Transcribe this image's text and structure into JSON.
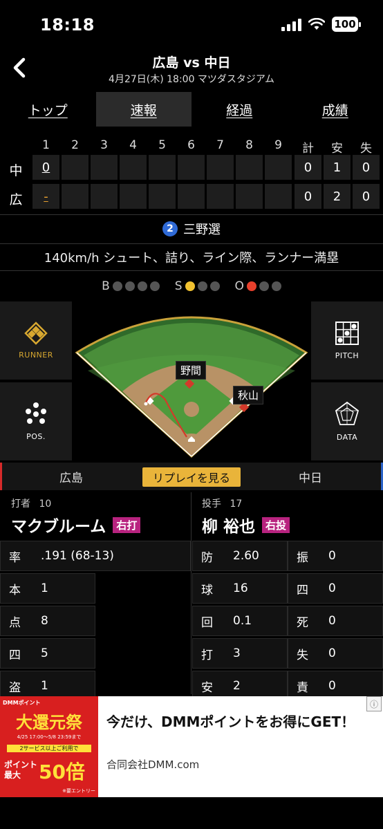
{
  "status_bar": {
    "time": "18:18",
    "battery": "100"
  },
  "header": {
    "title": "広島 vs 中日",
    "subtitle": "4月27日(木) 18:00 マツダスタジアム"
  },
  "tabs": [
    {
      "label": "トップ"
    },
    {
      "label": "速報"
    },
    {
      "label": "経過"
    },
    {
      "label": "成績"
    }
  ],
  "scoreboard": {
    "innings": [
      "1",
      "2",
      "3",
      "4",
      "5",
      "6",
      "7",
      "8",
      "9"
    ],
    "totals_headers": [
      "計",
      "安",
      "失"
    ],
    "rows": [
      {
        "team": "中",
        "innings": [
          "0",
          "",
          "",
          "",
          "",
          "",
          "",
          "",
          ""
        ],
        "totals": [
          "0",
          "1",
          "0"
        ]
      },
      {
        "team": "広",
        "innings": [
          "-",
          "",
          "",
          "",
          "",
          "",
          "",
          "",
          ""
        ],
        "totals": [
          "0",
          "2",
          "0"
        ]
      }
    ]
  },
  "at_bat": {
    "order": "2",
    "text": "三野選"
  },
  "play_description": "140km/h シュート、詰り、ライン際、ランナー満塁",
  "count": {
    "b_label": "B",
    "s_label": "S",
    "o_label": "O",
    "balls": 0,
    "strikes": 1,
    "outs": 1,
    "colors": {
      "strike": "#f2c230",
      "out": "#e8402c",
      "off": "#555555"
    }
  },
  "field": {
    "fielders": [
      "野間",
      "秋山"
    ],
    "buttons": {
      "runner": "RUNNER",
      "pitch": "PITCH",
      "pos": "POS.",
      "data": "DATA"
    }
  },
  "team_bar": {
    "home": "広島",
    "replay": "リプレイを見る",
    "away": "中日"
  },
  "batter": {
    "role": "打者",
    "number": "10",
    "name": "マクブルーム",
    "hand": "右打",
    "stats": [
      {
        "k": "率",
        "v": ".191 (68-13)"
      },
      {
        "k": "本",
        "v": "1"
      },
      {
        "k": "点",
        "v": "8"
      },
      {
        "k": "四",
        "v": "5"
      },
      {
        "k": "盗",
        "v": "1"
      }
    ]
  },
  "pitcher": {
    "role": "投手",
    "number": "17",
    "name": "柳 裕也",
    "hand": "右投",
    "stats_left": [
      {
        "k": "防",
        "v": "2.60"
      },
      {
        "k": "球",
        "v": "16"
      },
      {
        "k": "回",
        "v": "0.1"
      },
      {
        "k": "打",
        "v": "3"
      },
      {
        "k": "安",
        "v": "2"
      }
    ],
    "stats_right": [
      {
        "k": "振",
        "v": "0"
      },
      {
        "k": "四",
        "v": "0"
      },
      {
        "k": "死",
        "v": "0"
      },
      {
        "k": "失",
        "v": "0"
      },
      {
        "k": "責",
        "v": "0"
      }
    ]
  },
  "ad": {
    "image_text": {
      "top": "DMMポイント",
      "main": "大還元祭",
      "dates": "4/25 17:00～5/8 23:59まで",
      "note": "2サービス以上ご利用で",
      "badge": "ポイント最大",
      "mult": "50倍",
      "foot": "※要エントリー"
    },
    "headline": "今だけ、DMMポイントをお得にGET！",
    "brand": "合同会社DMM.com"
  }
}
